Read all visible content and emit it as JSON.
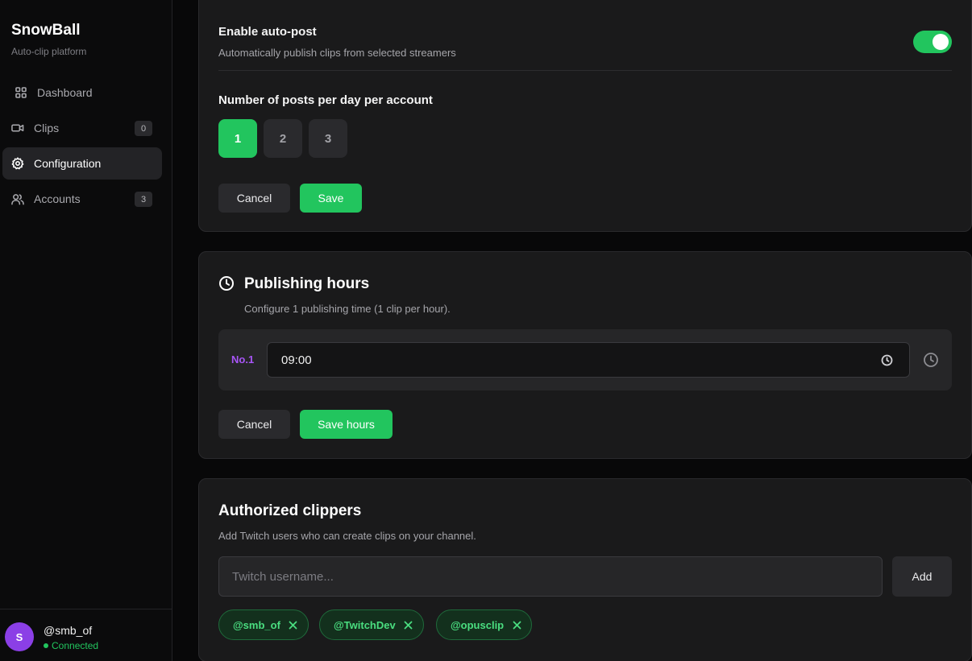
{
  "app": {
    "name": "SnowBall",
    "subtitle": "Auto-clip platform"
  },
  "sidebar": {
    "items": [
      {
        "label": "Dashboard",
        "icon": "grid-icon",
        "badge": null,
        "active": false
      },
      {
        "label": "Clips",
        "icon": "video-icon",
        "badge": "0",
        "active": false
      },
      {
        "label": "Configuration",
        "icon": "gear-icon",
        "badge": null,
        "active": true
      },
      {
        "label": "Accounts",
        "icon": "users-icon",
        "badge": "3",
        "active": false
      }
    ]
  },
  "user": {
    "initial": "S",
    "name": "@smb_of",
    "status": "Connected"
  },
  "autopost": {
    "title": "Enable auto-post",
    "description": "Automatically publish clips from selected streamers",
    "enabled": true,
    "posts_label": "Number of posts per day per account",
    "options": [
      "1",
      "2",
      "3"
    ],
    "selected": "1",
    "cancel_label": "Cancel",
    "save_label": "Save"
  },
  "publishing": {
    "title": "Publishing hours",
    "description": "Configure 1 publishing time (1 clip per hour).",
    "slots": [
      {
        "label": "No.1",
        "time": "09:00"
      }
    ],
    "cancel_label": "Cancel",
    "save_label": "Save hours"
  },
  "clippers": {
    "title": "Authorized clippers",
    "description": "Add Twitch users who can create clips on your channel.",
    "input_placeholder": "Twitch username...",
    "input_value": "",
    "add_label": "Add",
    "chips": [
      "@smb_of",
      "@TwitchDev",
      "@opusclip"
    ]
  },
  "colors": {
    "accent": "#22c55e",
    "slot_label": "#a855f7",
    "avatar": "#8b3fe6"
  }
}
